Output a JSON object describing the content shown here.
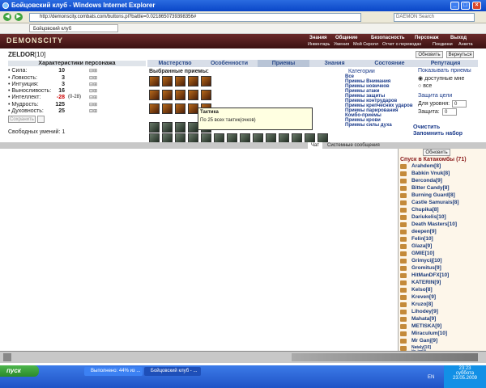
{
  "window": {
    "title": "Бойцовский клуб - Windows Internet Explorer"
  },
  "address": {
    "url": "http://demonscity.combats.com/buttons.pl?battle=0.0218650739398356#",
    "search_placeholder": "DAEMON Search"
  },
  "tab": {
    "label": "Бойцовский клуб"
  },
  "game": {
    "logo": "DEMONSCITY",
    "menu_top": [
      "Знания",
      "Общение",
      "Безопасность",
      "Персонаж",
      "Выход"
    ],
    "menu_bottom": [
      "Инвентарь",
      "Умения",
      "Мой Скролл",
      "Отчет о переводах",
      "Поединки",
      "Анкета"
    ],
    "char_name": "ZELDOR",
    "char_level": "[10]",
    "btn_update": "Обновить",
    "btn_back": "Вернуться",
    "tabs": [
      "Мастерство",
      "Особенности",
      "Приемы",
      "Знания",
      "Состояние",
      "Репутация"
    ],
    "stats_title": "Характеристики персонажа",
    "stats": [
      {
        "label": "• Сила:",
        "value": "10",
        "extra": ""
      },
      {
        "label": "• Ловкость:",
        "value": "3",
        "extra": ""
      },
      {
        "label": "• Интуиция:",
        "value": "3",
        "extra": ""
      },
      {
        "label": "• Выносливость:",
        "value": "16",
        "extra": ""
      },
      {
        "label": "• Интеллект:",
        "value": "-28",
        "extra": "(0-28)"
      },
      {
        "label": "• Мудрость:",
        "value": "125",
        "extra": ""
      },
      {
        "label": "• Духовность:",
        "value": "25",
        "extra": ""
      }
    ],
    "save_btn": "Сохранить",
    "free_skills": "Свободных умений:  1",
    "chosen_title": "Выбранные приемы:",
    "tooltip_title": "Тактика",
    "tooltip_text": "По 25 всех тактик(очков)",
    "categories_title": "Категории",
    "categories": [
      "Все",
      "Приемы Внимания",
      "Приемы новичков",
      "Приемы атаки",
      "Приемы защиты",
      "Приемы контрударов",
      "Приемы крепчесних ударов",
      "Приемы парирования",
      "Комбо-приемы",
      "Приемы крови",
      "Приемы силы духа"
    ],
    "show_title": "Показывать приемы",
    "show_opts": [
      "доступные мне",
      "все"
    ],
    "protect_title": "Защита цели",
    "level_label": "Для уровня:",
    "level_val": "0",
    "protect_label": "Защита:",
    "protect_val": "0",
    "clear": "Очистить",
    "remember": "Запомнить набор",
    "chat_tab": "Чат",
    "sys_tab": "Системные сообщения",
    "refresh": "Обновить",
    "location": "Спуск в Катакомбы (71)",
    "users": [
      "Arahdem[8]",
      "Babkin Vnuk[8]",
      "Berconda[9]",
      "Bitter Candy[8]",
      "Burning Guard[8]",
      "Castle Samurais[8]",
      "Chupika[8]",
      "Dariukelis[10]",
      "Death Masters[10]",
      "deepen[9]",
      "Felin[10]",
      "Glaza[9]",
      "GMIE[10]",
      "Grimycij[10]",
      "Gromitus[9]",
      "HitManDFX[10]",
      "KATERIN[9]",
      "Kelso[8]",
      "Kreven[9]",
      "Kruzo[8]",
      "Lihodey[9]",
      "Mahata[9]",
      "METISKA[9]",
      "Miraculum[10]",
      "Mr Ganj[9]",
      "Nataly[10]",
      "No_Iea[9]"
    ]
  },
  "taskbar": {
    "start": "пуск",
    "tasks": [
      "Выполнено: 44% из ...",
      "Бойцовский клуб - ..."
    ],
    "lang": "EN",
    "time": "23:23",
    "day": "суббота",
    "date": "23.05.2009"
  }
}
